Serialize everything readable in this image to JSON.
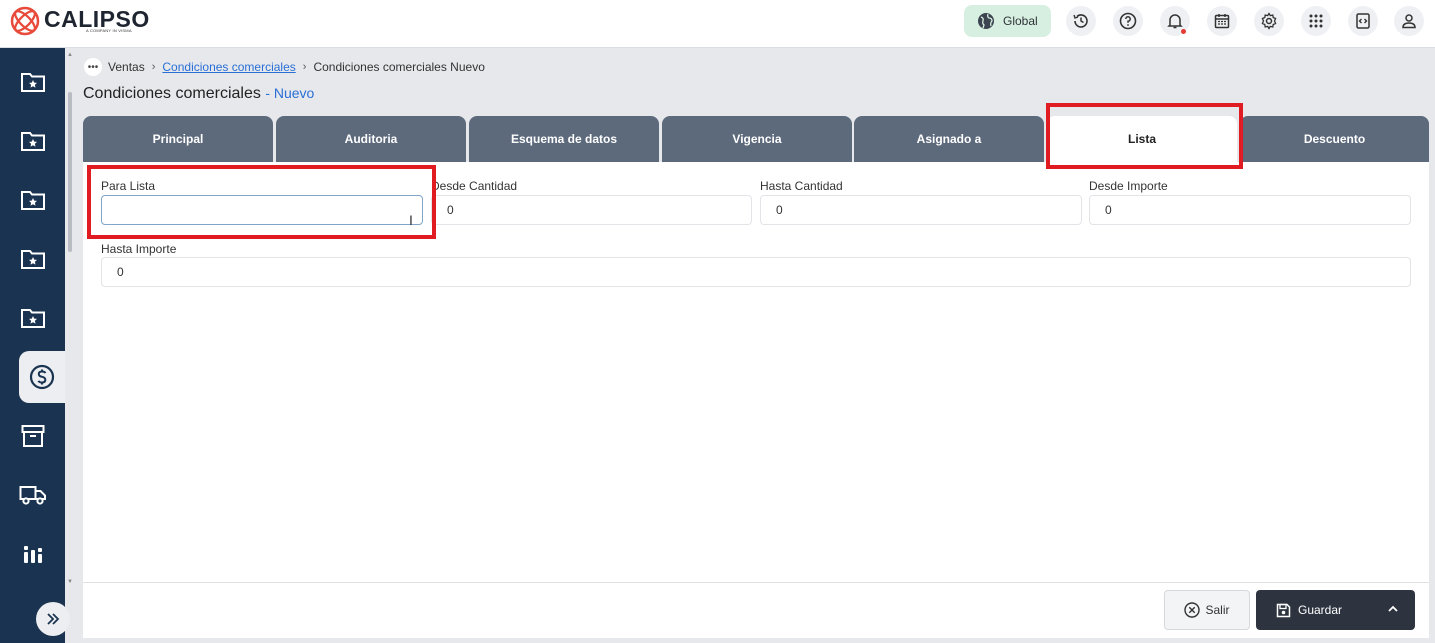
{
  "header": {
    "logo_text": "CALIPSO",
    "logo_subtext": "A COMPANY IN VISMA",
    "global_label": "Global",
    "icons": [
      "history-icon",
      "help-icon",
      "bell-icon",
      "calendar-icon",
      "gear-icon",
      "apps-grid-icon",
      "code-icon",
      "user-icon"
    ]
  },
  "sidebar": {
    "items": [
      "folder-star-icon",
      "folder-star-icon",
      "folder-star-icon",
      "folder-star-icon",
      "folder-star-icon",
      "dollar-icon",
      "archive-icon",
      "truck-icon",
      "chart-icon"
    ],
    "active_index": 5
  },
  "breadcrumb": {
    "items": [
      "Ventas",
      "Condiciones comerciales",
      "Condiciones comerciales Nuevo"
    ]
  },
  "page": {
    "title": "Condiciones comerciales",
    "subtitle": "- Nuevo"
  },
  "tabs": [
    {
      "label": "Principal"
    },
    {
      "label": "Auditoria"
    },
    {
      "label": "Esquema de datos"
    },
    {
      "label": "Vigencia"
    },
    {
      "label": "Asignado a"
    },
    {
      "label": "Lista"
    },
    {
      "label": "Descuento"
    }
  ],
  "active_tab": "Lista",
  "form": {
    "para_lista": {
      "label": "Para Lista",
      "value": ""
    },
    "desde_cantidad": {
      "label": "Desde Cantidad",
      "value": "0"
    },
    "hasta_cantidad": {
      "label": "Hasta Cantidad",
      "value": "0"
    },
    "desde_importe": {
      "label": "Desde Importe",
      "value": "0"
    },
    "hasta_importe": {
      "label": "Hasta Importe",
      "value": "0"
    }
  },
  "footer": {
    "salir_label": "Salir",
    "guardar_label": "Guardar"
  },
  "colors": {
    "sidebar": "#1a3350",
    "tab": "#5d6a7c",
    "highlight": "#e01b22",
    "accent": "#2a6fd6"
  }
}
